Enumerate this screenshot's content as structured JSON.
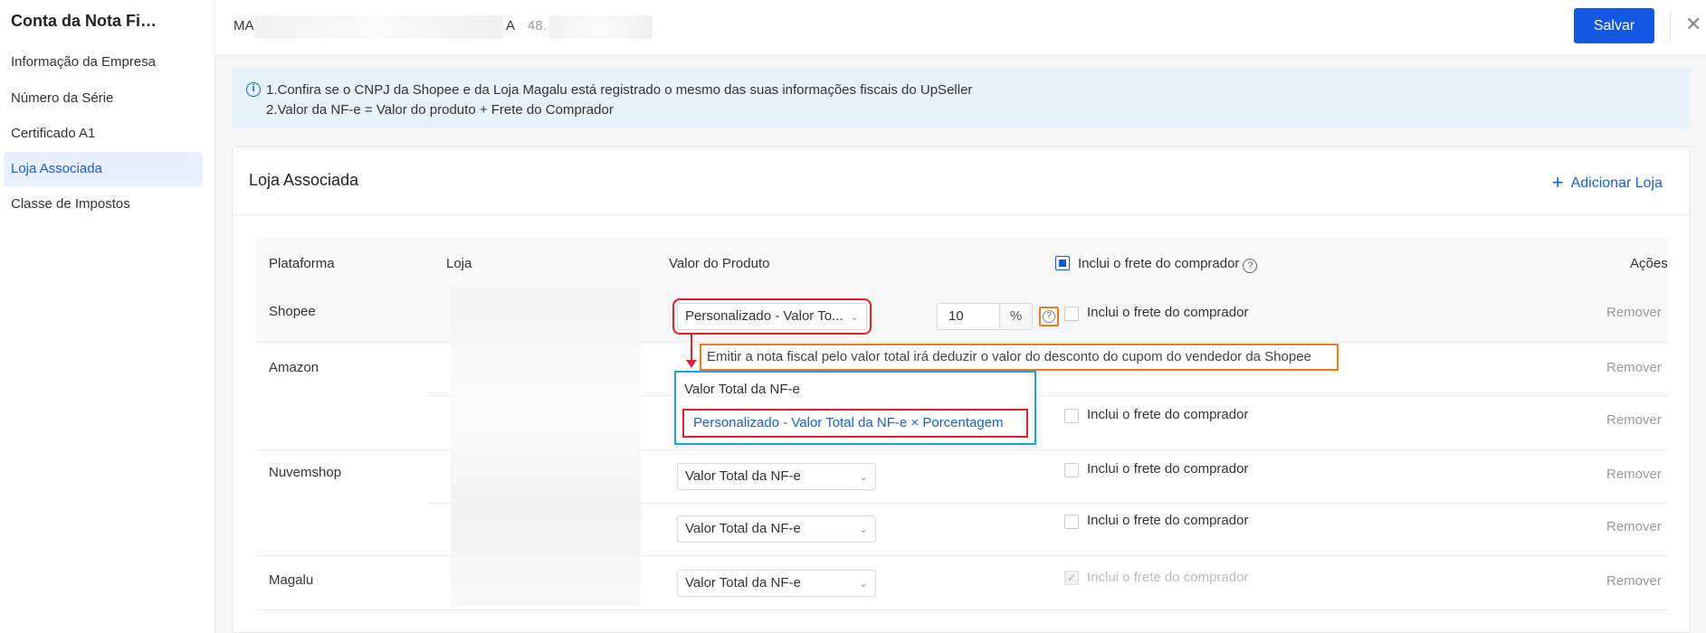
{
  "sidebar": {
    "title": "Conta da Nota Fi…",
    "items": [
      {
        "label": "Informação da Empresa",
        "active": false
      },
      {
        "label": "Número da Série",
        "active": false
      },
      {
        "label": "Certificado A1",
        "active": false
      },
      {
        "label": "Loja Associada",
        "active": true
      },
      {
        "label": "Classe de Impostos",
        "active": false
      }
    ]
  },
  "header": {
    "company_prefix": "MA",
    "company_suffix": "A",
    "company_id": "48.",
    "save_label": "Salvar",
    "close_symbol": "✕"
  },
  "notice": {
    "line1": "1.Confira se o CNPJ da Shopee e da Loja Magalu está registrado o mesmo das suas informações fiscais do UpSeller",
    "line2": "2.Valor da NF-e = Valor do produto + Frete do Comprador"
  },
  "card": {
    "title": "Loja Associada",
    "add_label": "Adicionar Loja"
  },
  "table": {
    "headers": {
      "platform": "Plataforma",
      "store": "Loja",
      "product_value": "Valor do Produto",
      "freight": "Inclui o frete do comprador",
      "actions": "Ações"
    },
    "rows": [
      {
        "platform": "Shopee",
        "select": "Personalizado - Valor To...",
        "percent": "10",
        "percent_unit": "%",
        "freight": "Inclui o frete do comprador",
        "action": "Remover"
      },
      {
        "platform": "Amazon",
        "action": "Remover"
      },
      {
        "platform": "",
        "freight": "Inclui o frete do comprador",
        "action": "Remover"
      },
      {
        "platform": "Nuvemshop",
        "select": "Valor Total da NF-e",
        "freight": "Inclui o frete do comprador",
        "action": "Remover"
      },
      {
        "platform": "",
        "select": "Valor Total da NF-e",
        "freight": "Inclui o frete do comprador",
        "action": "Remover"
      },
      {
        "platform": "Magalu",
        "select": "Valor Total da NF-e",
        "freight": "Inclui o frete do comprador",
        "action": "Remover"
      }
    ]
  },
  "dropdown": {
    "options": [
      "Valor Total da NF-e",
      "Personalizado - Valor Total da NF-e × Porcentagem"
    ]
  },
  "tooltip": {
    "text": "Emitir a nota fiscal pelo valor total irá deduzir o valor do desconto do cupom do vendedor da Shopee"
  },
  "colors": {
    "primary": "#1357e3",
    "highlight_red": "#e0202a",
    "highlight_orange": "#f07a1f",
    "highlight_blue": "#1ea0db"
  }
}
